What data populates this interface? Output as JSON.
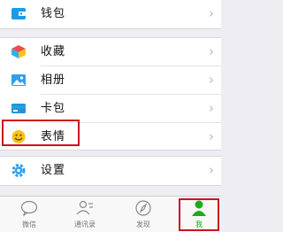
{
  "menu": {
    "wallet": "钱包",
    "favorites": "收藏",
    "album": "相册",
    "cards": "卡包",
    "stickers": "表情",
    "settings": "设置"
  },
  "chevron": "›",
  "tabs": {
    "chats": "微信",
    "contacts": "通讯录",
    "discover": "发现",
    "me": "我"
  },
  "colors": {
    "accent": "#1aad19",
    "highlight_box": "#c9151d",
    "wallet_icon": "#1a9be6",
    "sticker_icon": "#f6c21b"
  }
}
